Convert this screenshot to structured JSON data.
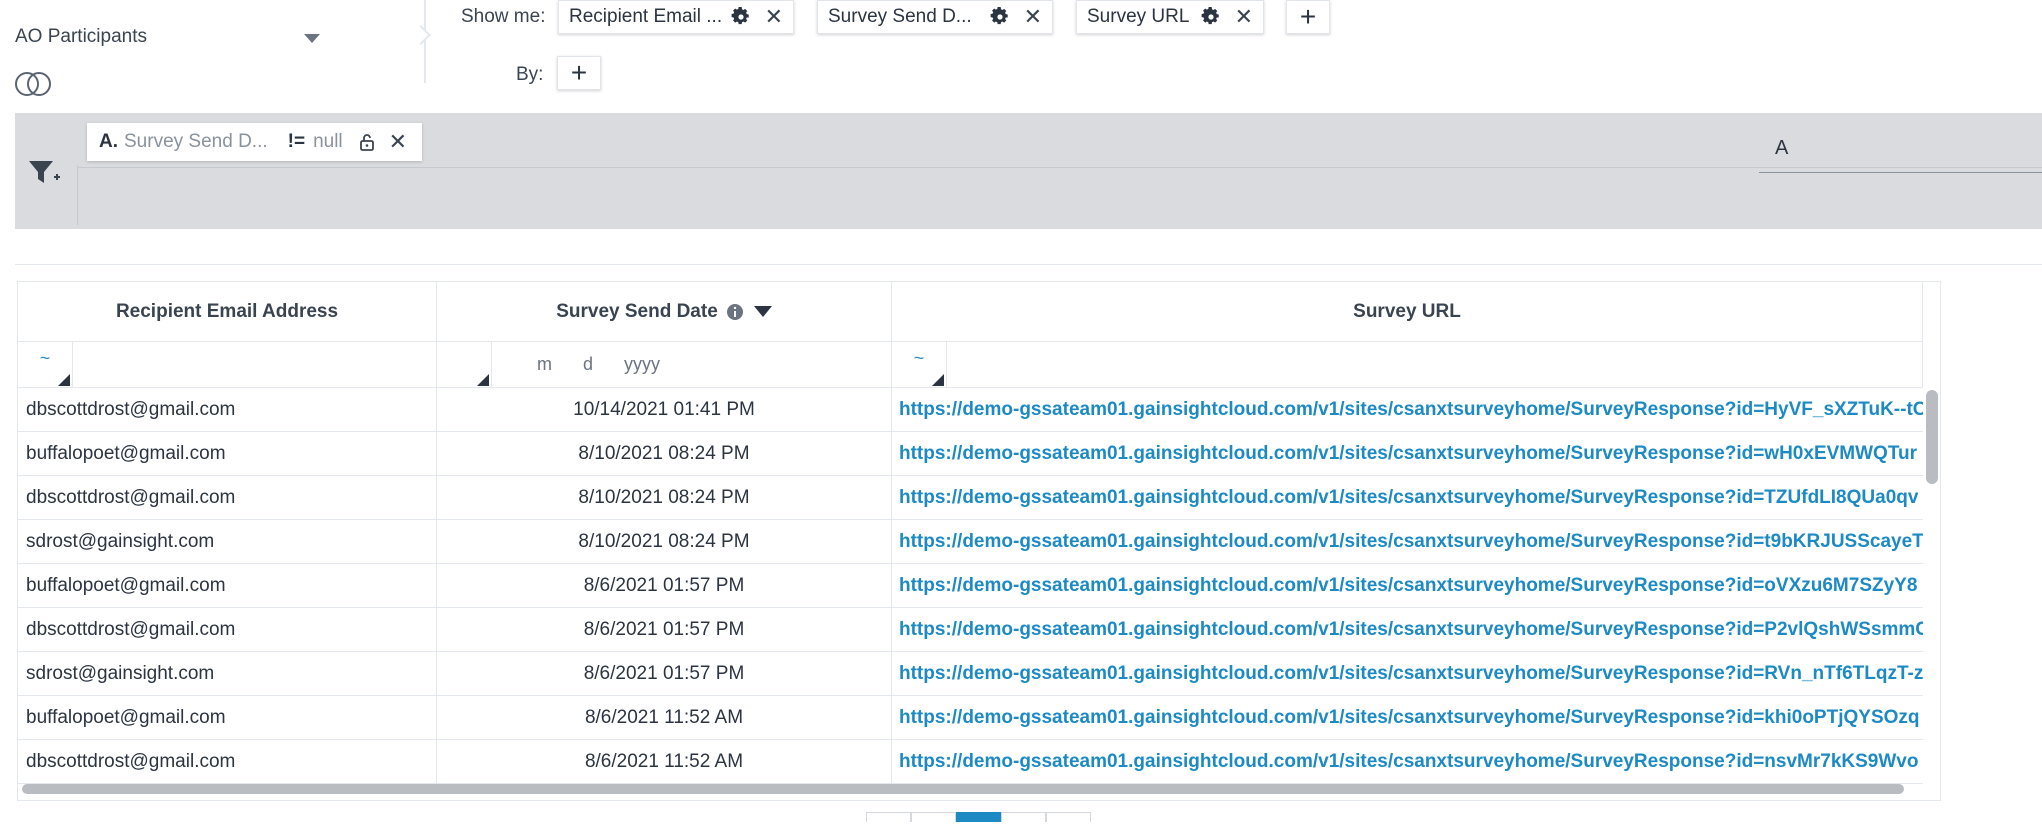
{
  "source": {
    "label": "AO Participants"
  },
  "builder": {
    "show_me_label": "Show me:",
    "by_label": "By:",
    "fields": [
      {
        "label": "Recipient Email ..."
      },
      {
        "label": "Survey Send D..."
      },
      {
        "label": "Survey URL"
      }
    ]
  },
  "filter": {
    "letter": "A.",
    "field": "Survey Send D...",
    "operator": "!=",
    "value": "null",
    "logic": "A"
  },
  "table": {
    "columns": [
      "Recipient Email Address",
      "Survey Send Date",
      "Survey URL"
    ],
    "filter_op_symbol": "~",
    "date_mask": "m d yyyy",
    "rows": [
      {
        "email": "dbscottdrost@gmail.com",
        "date": "10/14/2021 01:41 PM",
        "url": "https://demo-gssateam01.gainsightcloud.com/v1/sites/csanxtsurveyhome/SurveyResponse?id=HyVF_sXZTuK--tC"
      },
      {
        "email": "buffalopoet@gmail.com",
        "date": "8/10/2021 08:24 PM",
        "url": "https://demo-gssateam01.gainsightcloud.com/v1/sites/csanxtsurveyhome/SurveyResponse?id=wH0xEVMWQTur"
      },
      {
        "email": "dbscottdrost@gmail.com",
        "date": "8/10/2021 08:24 PM",
        "url": "https://demo-gssateam01.gainsightcloud.com/v1/sites/csanxtsurveyhome/SurveyResponse?id=TZUfdLI8QUa0qv"
      },
      {
        "email": "sdrost@gainsight.com",
        "date": "8/10/2021 08:24 PM",
        "url": "https://demo-gssateam01.gainsightcloud.com/v1/sites/csanxtsurveyhome/SurveyResponse?id=t9bKRJUSScayeT"
      },
      {
        "email": "buffalopoet@gmail.com",
        "date": "8/6/2021 01:57 PM",
        "url": "https://demo-gssateam01.gainsightcloud.com/v1/sites/csanxtsurveyhome/SurveyResponse?id=oVXzu6M7SZyY8"
      },
      {
        "email": "dbscottdrost@gmail.com",
        "date": "8/6/2021 01:57 PM",
        "url": "https://demo-gssateam01.gainsightcloud.com/v1/sites/csanxtsurveyhome/SurveyResponse?id=P2vlQshWSsmmC"
      },
      {
        "email": "sdrost@gainsight.com",
        "date": "8/6/2021 01:57 PM",
        "url": "https://demo-gssateam01.gainsightcloud.com/v1/sites/csanxtsurveyhome/SurveyResponse?id=RVn_nTf6TLqzT-z"
      },
      {
        "email": "buffalopoet@gmail.com",
        "date": "8/6/2021 11:52 AM",
        "url": "https://demo-gssateam01.gainsightcloud.com/v1/sites/csanxtsurveyhome/SurveyResponse?id=khi0oPTjQYSOzq"
      },
      {
        "email": "dbscottdrost@gmail.com",
        "date": "8/6/2021 11:52 AM",
        "url": "https://demo-gssateam01.gainsightcloud.com/v1/sites/csanxtsurveyhome/SurveyResponse?id=nsvMr7kKS9Wvo"
      }
    ]
  },
  "colors": {
    "link": "#1d8ac3",
    "filter_bar": "#d9dbde",
    "pager_active": "#1d8ac3"
  }
}
